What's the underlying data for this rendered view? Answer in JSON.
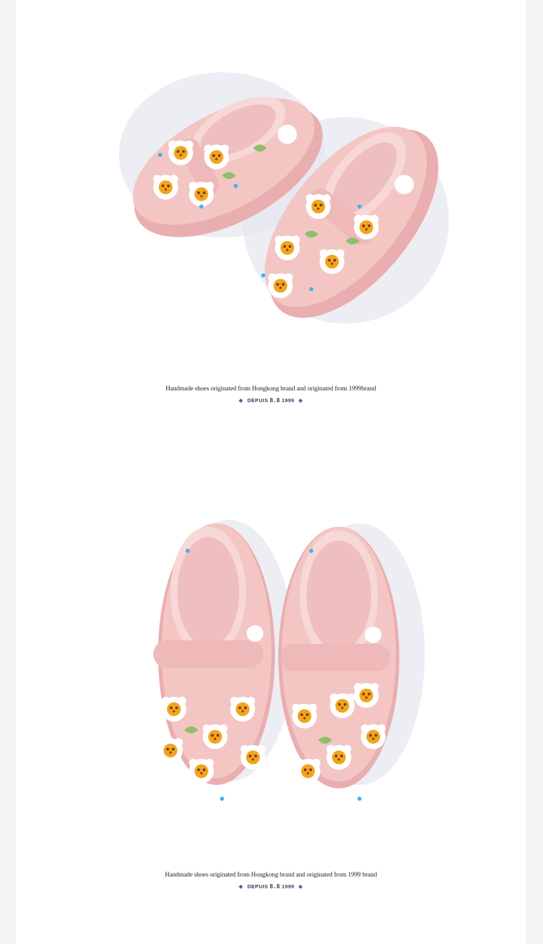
{
  "section1": {
    "photo_label": "pink-kids-clogs-side-view",
    "caption": "Handmade shoes originated from Hongkong brand and originated from 1999brand",
    "tagline": {
      "prefix": "DEPUIS",
      "mark": "B.B",
      "year": "1999"
    }
  },
  "section2": {
    "photo_label": "pink-kids-clogs-top-view",
    "caption": "Handmade shoes originated from Hongkong brand and originated from 1999 brand",
    "tagline": {
      "prefix": "DEPUIS",
      "mark": "B.B",
      "year": "1999"
    }
  },
  "colors": {
    "background": "#ffffff",
    "outer": "#f3f3f3",
    "shoe_pink": "#f3c6c4",
    "shoe_dark": "#e9aeb0",
    "bear_white": "#ffffff",
    "bear_yellow": "#f2a41c",
    "bear_brown": "#7a3b25",
    "dot_blue": "#3fb4e8",
    "leaf_green": "#8fbf6a",
    "accent_diamond": "#4d5ea8"
  }
}
